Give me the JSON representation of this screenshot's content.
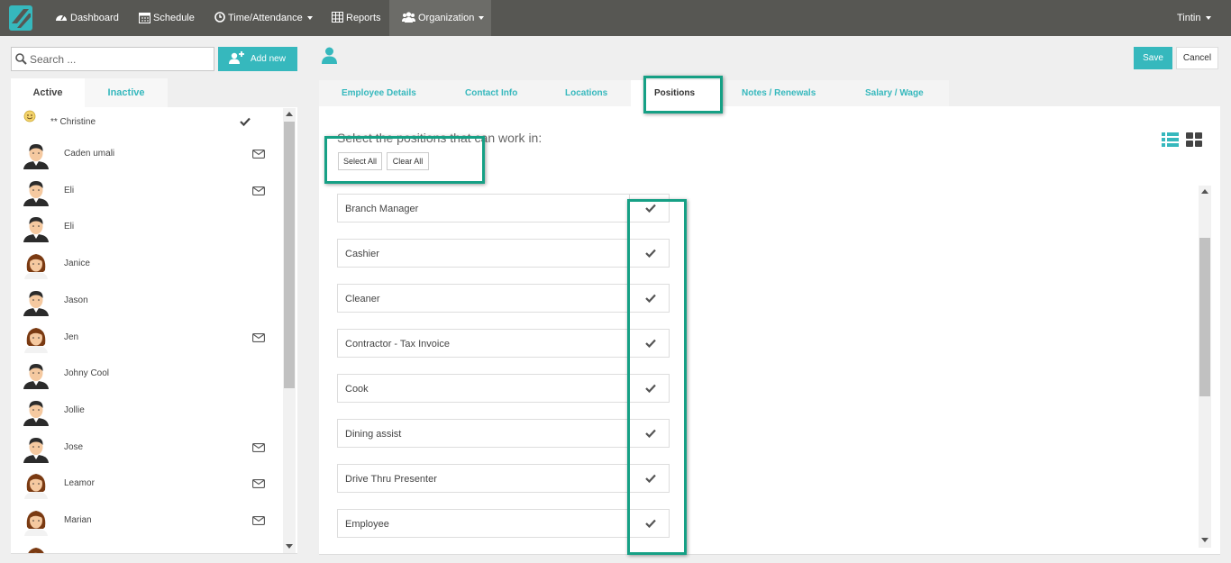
{
  "nav": {
    "items": [
      {
        "label": "Dashboard",
        "icon": "dashboard-icon"
      },
      {
        "label": "Schedule",
        "icon": "calendar-icon"
      },
      {
        "label": "Time/Attendance",
        "icon": "clock-icon"
      },
      {
        "label": "Reports",
        "icon": "table-icon"
      },
      {
        "label": "Organization",
        "icon": "users-icon"
      }
    ],
    "user": "Tintin"
  },
  "search": {
    "placeholder": "Search ..."
  },
  "add_new_label": "Add new",
  "employee_tabs": {
    "active": "Active",
    "inactive": "Inactive"
  },
  "employees": [
    {
      "name": "** Christine",
      "avatar": "smiley",
      "status": "check"
    },
    {
      "name": "Caden umali",
      "avatar": "male",
      "status": "mail"
    },
    {
      "name": "Eli",
      "avatar": "male",
      "status": "mail"
    },
    {
      "name": "Eli",
      "avatar": "male",
      "status": ""
    },
    {
      "name": "Janice",
      "avatar": "female",
      "status": ""
    },
    {
      "name": "Jason",
      "avatar": "male",
      "status": ""
    },
    {
      "name": "Jen",
      "avatar": "female",
      "status": "mail"
    },
    {
      "name": "Johny Cool",
      "avatar": "male",
      "status": ""
    },
    {
      "name": "Jollie",
      "avatar": "male",
      "status": ""
    },
    {
      "name": "Jose",
      "avatar": "male",
      "status": "mail"
    },
    {
      "name": "Leamor",
      "avatar": "female",
      "status": "mail"
    },
    {
      "name": "Marian",
      "avatar": "female",
      "status": "mail"
    },
    {
      "name": "",
      "avatar": "female",
      "status": ""
    }
  ],
  "actions": {
    "save": "Save",
    "cancel": "Cancel"
  },
  "tabs": [
    {
      "label": "Employee Details"
    },
    {
      "label": "Contact Info"
    },
    {
      "label": "Locations"
    },
    {
      "label": "Positions",
      "active": true
    },
    {
      "label": "Notes / Renewals"
    },
    {
      "label": "Salary / Wage"
    }
  ],
  "positions_panel": {
    "prompt": "Select the positions that can work in:",
    "select_all": "Select All",
    "clear_all": "Clear All"
  },
  "positions": [
    {
      "name": "Branch Manager",
      "checked": true
    },
    {
      "name": "Cashier",
      "checked": true
    },
    {
      "name": "Cleaner",
      "checked": true
    },
    {
      "name": "Contractor - Tax Invoice",
      "checked": true
    },
    {
      "name": "Cook",
      "checked": true
    },
    {
      "name": "Dining assist",
      "checked": true
    },
    {
      "name": "Drive Thru Presenter",
      "checked": true
    },
    {
      "name": "Employee",
      "checked": true
    }
  ],
  "colors": {
    "accent": "#36b8bd",
    "nav_bg": "#575753",
    "highlight": "#16a085"
  }
}
